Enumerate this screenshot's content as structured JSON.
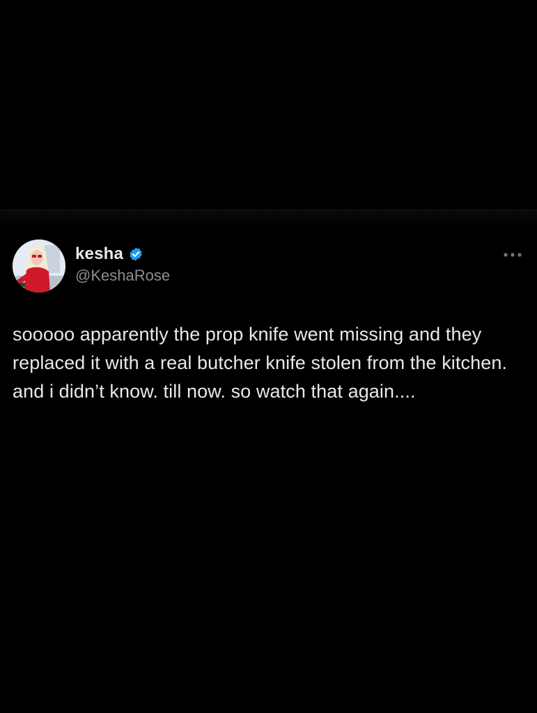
{
  "tweet": {
    "author": {
      "display_name": "kesha",
      "handle": "@KeshaRose",
      "verified": true,
      "avatar_icon": "profile-avatar"
    },
    "text": "sooooo apparently the prop knife went missing and they replaced it with a real butcher knife stolen from the kitchen. and i didn’t know. till now. so watch that again....",
    "more_icon": "ellipsis-icon"
  },
  "colors": {
    "background": "#000000",
    "text_primary": "#e7e9ea",
    "text_secondary": "#8b8f94",
    "verified_blue": "#1d9bf0"
  }
}
